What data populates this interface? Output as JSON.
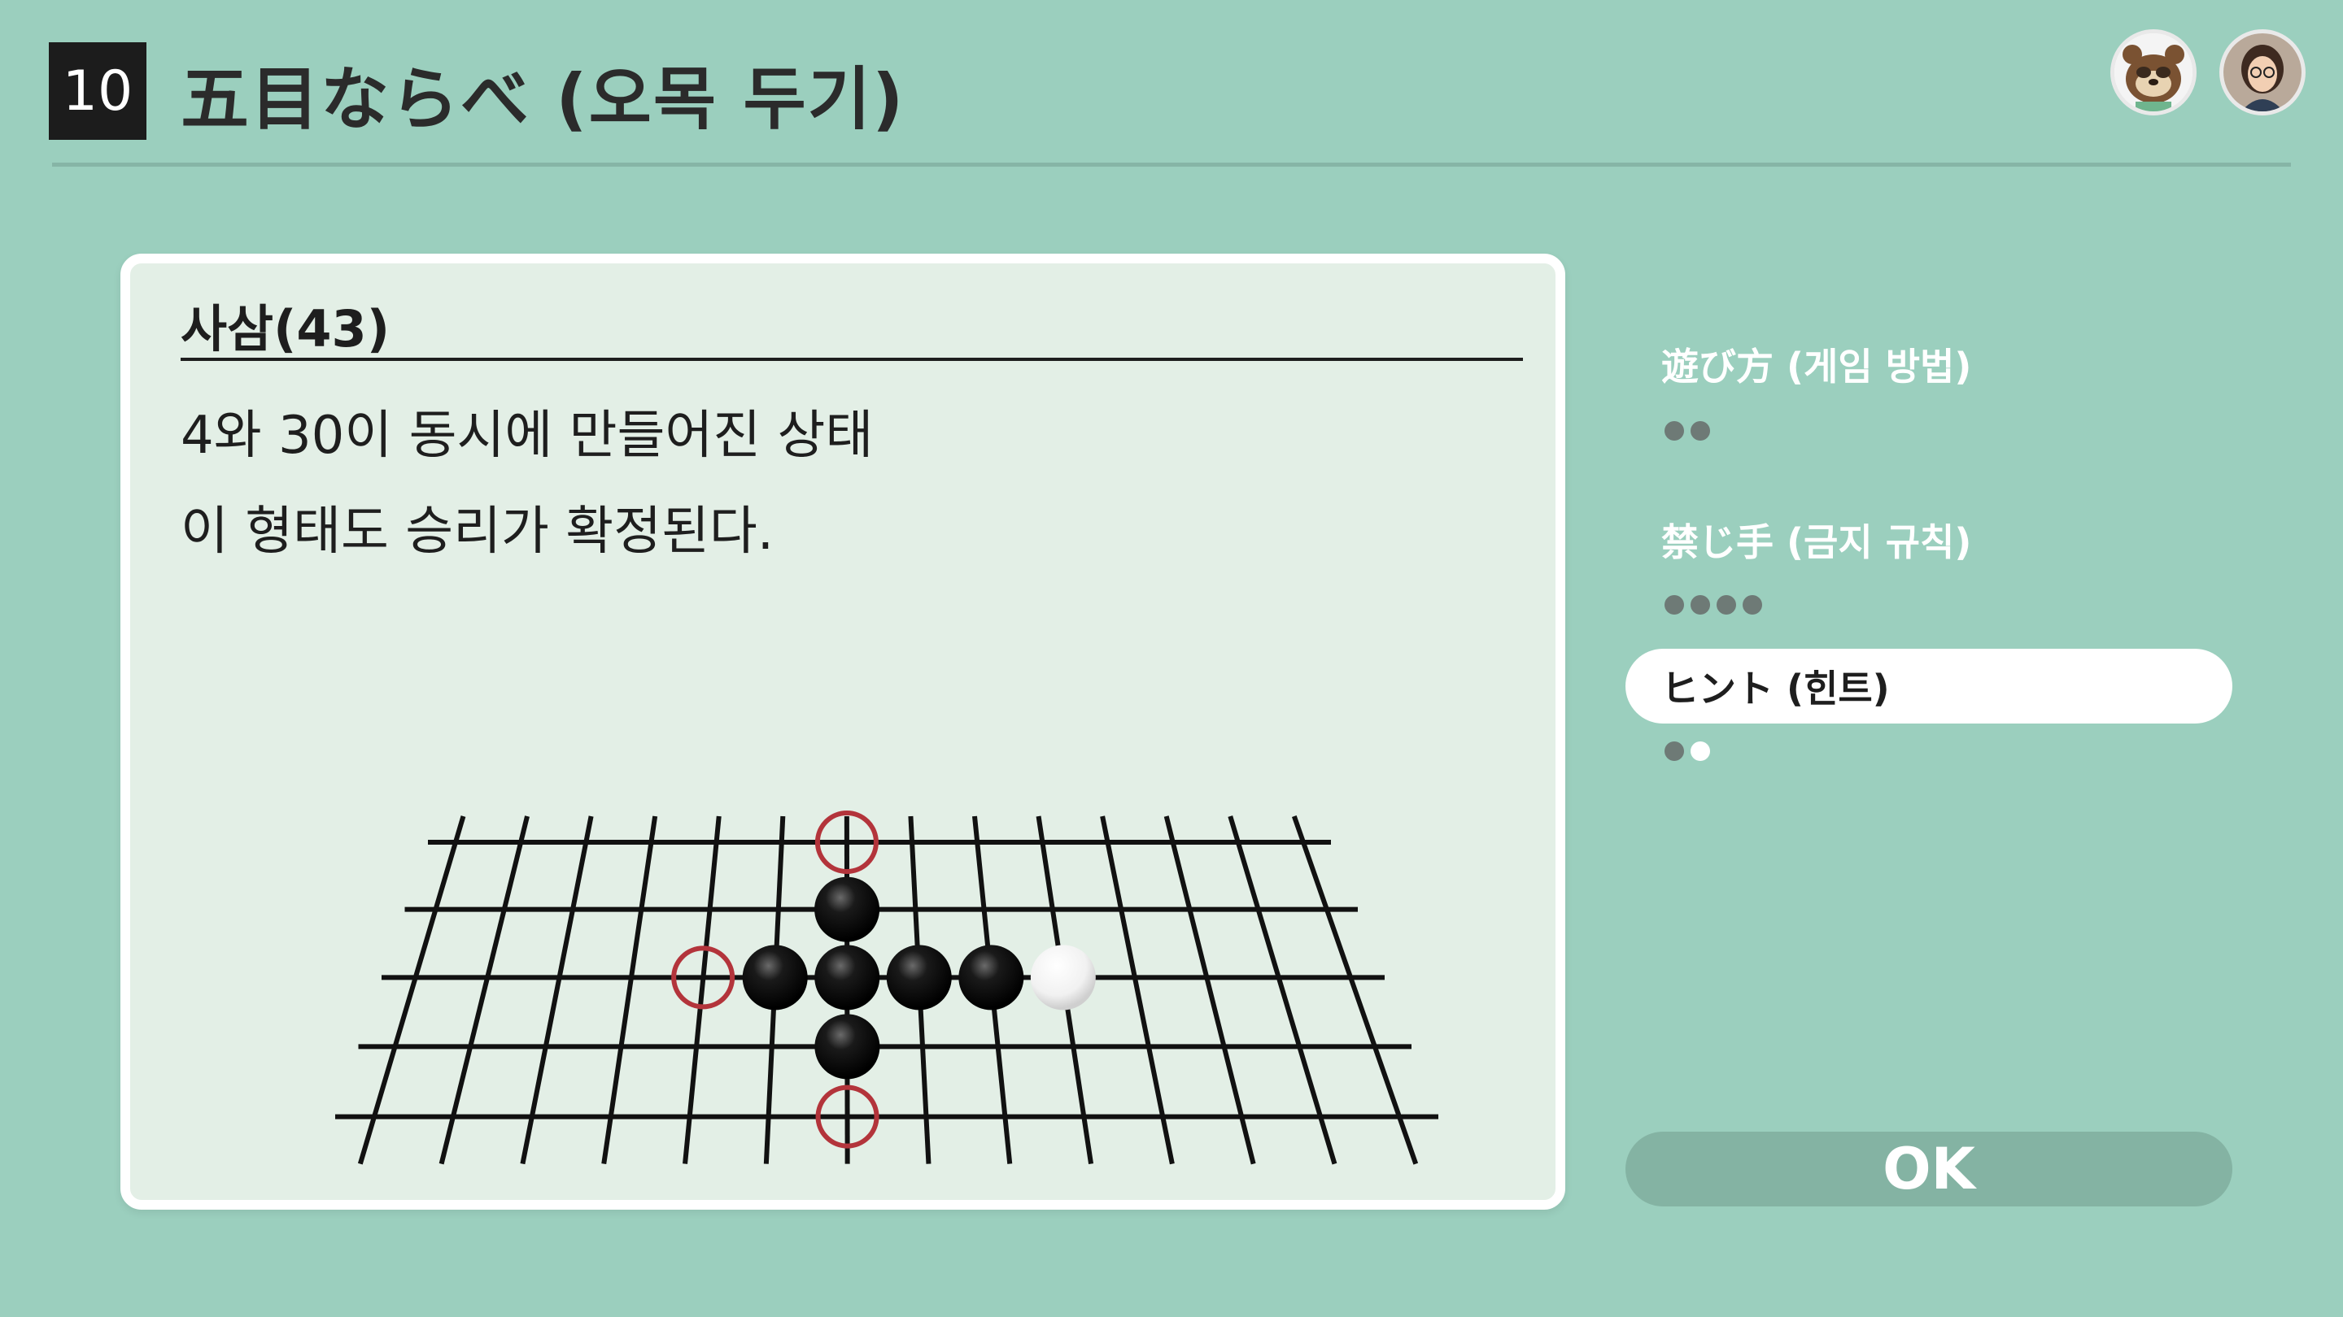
{
  "header": {
    "lesson_number": "10",
    "title": "五目ならべ (오목 두기)"
  },
  "avatars": [
    {
      "name": "tom-nook-avatar"
    },
    {
      "name": "player-avatar"
    }
  ],
  "card": {
    "title": "사삼(43)",
    "lines": [
      "4와 30이 동시에 만들어진 상태",
      "이 형태도 승리가 확정된다."
    ]
  },
  "board": {
    "stones": [
      {
        "col": 6,
        "row": 1,
        "color": "black"
      },
      {
        "col": 5,
        "row": 2,
        "color": "black"
      },
      {
        "col": 6,
        "row": 2,
        "color": "black"
      },
      {
        "col": 7,
        "row": 2,
        "color": "black"
      },
      {
        "col": 8,
        "row": 2,
        "color": "black"
      },
      {
        "col": 9,
        "row": 2,
        "color": "white"
      },
      {
        "col": 6,
        "row": 3,
        "color": "black"
      }
    ],
    "markers": [
      {
        "col": 6,
        "row": 0
      },
      {
        "col": 4,
        "row": 2
      },
      {
        "col": 6,
        "row": 4
      }
    ],
    "marker_color": "#b3343b"
  },
  "menu": {
    "items": [
      {
        "label": "遊び方 (게임 방법)",
        "pages": 2,
        "current": 0,
        "active": false
      },
      {
        "label": "禁じ手 (금지 규칙)",
        "pages": 4,
        "current": 0,
        "active": false
      },
      {
        "label": "ヒント (힌트)",
        "pages": 2,
        "current": 2,
        "active": true
      }
    ]
  },
  "ok_label": "OK",
  "colors": {
    "background": "#9bcfbe",
    "card": "#e3efe6",
    "accent_inactive": "#84b3a3"
  }
}
